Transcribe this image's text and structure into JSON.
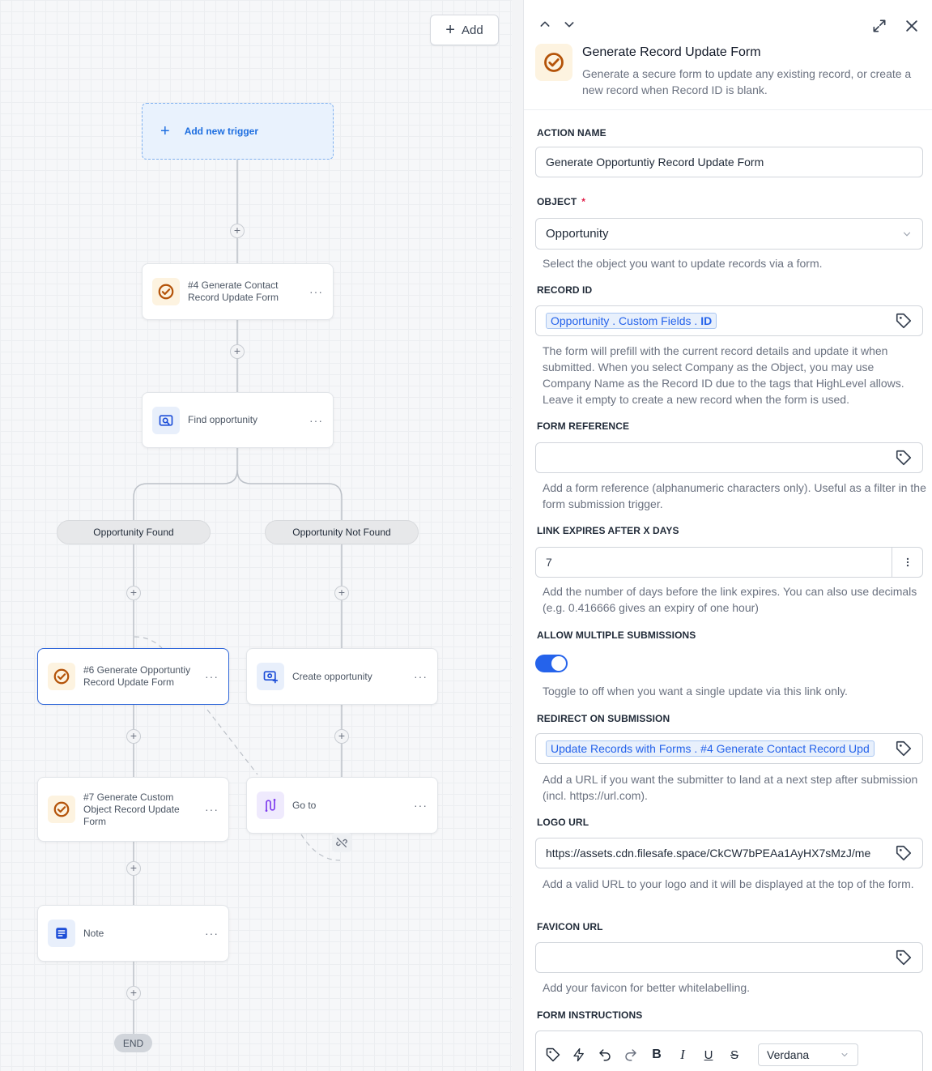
{
  "canvas": {
    "add_button_label": "Add",
    "trigger_label": "Add new trigger",
    "nodes": {
      "n4": "#4 Generate Contact Record Update Form",
      "find": "Find opportunity",
      "n6": "#6 Generate Opportuntiy Record Update Form",
      "create": "Create opportunity",
      "n7": "#7 Generate Custom Object Record Update Form",
      "goto": "Go to",
      "note": "Note"
    },
    "branches": {
      "found": "Opportunity Found",
      "not_found": "Opportunity Not Found"
    },
    "end_label": "END",
    "node_menu": "···"
  },
  "panel": {
    "title": "Generate Record Update Form",
    "description": "Generate a secure form to update any existing record, or create a new record when Record ID is blank.",
    "fields": {
      "action_name": {
        "label": "ACTION NAME",
        "value": "Generate Opportuntiy Record Update Form"
      },
      "object": {
        "label": "OBJECT",
        "required": "*",
        "value": "Opportunity",
        "help": "Select the object you want to update records via a form."
      },
      "record_id": {
        "label": "RECORD ID",
        "chip_prefix": "Opportunity . Custom Fields .",
        "chip_bold": "ID",
        "help": "The form will prefill with the current record details and update it when submitted. When you select Company as the Object, you may use Company Name as the Record ID due to the tags that HighLevel allows. Leave it empty to create a new record when the form is used."
      },
      "form_reference": {
        "label": "FORM REFERENCE",
        "value": "",
        "help": "Add a form reference (alphanumeric characters only). Useful as a filter in the form submission trigger."
      },
      "link_expires": {
        "label": "LINK EXPIRES AFTER X DAYS",
        "value": "7",
        "help": "Add the number of days before the link expires. You can also use decimals (e.g. 0.416666 gives an expiry of one hour)"
      },
      "allow_multiple": {
        "label": "ALLOW MULTIPLE SUBMISSIONS",
        "enabled": true,
        "help": "Toggle to off when you want a single update via this link only."
      },
      "redirect": {
        "label": "REDIRECT ON SUBMISSION",
        "chip": "Update Records with Forms . #4 Generate Contact Record Upd",
        "help": "Add a URL if you want the submitter to land at a next step after submission (incl. https://url.com)."
      },
      "logo_url": {
        "label": "LOGO URL",
        "value": "https://assets.cdn.filesafe.space/CkCW7bPEAa1AyHX7sMzJ/me",
        "help": "Add a valid URL to your logo and it will be displayed at the top of the form."
      },
      "favicon_url": {
        "label": "FAVICON URL",
        "value": "",
        "help": "Add your favicon for better whitelabelling."
      },
      "form_instructions": {
        "label": "FORM INSTRUCTIONS",
        "font": "Verdana"
      }
    }
  },
  "colors": {
    "accent": "#2563eb",
    "brand_orange": "#b45309",
    "icon_blue": "#1d4ed8",
    "icon_purple": "#7c3aed"
  }
}
